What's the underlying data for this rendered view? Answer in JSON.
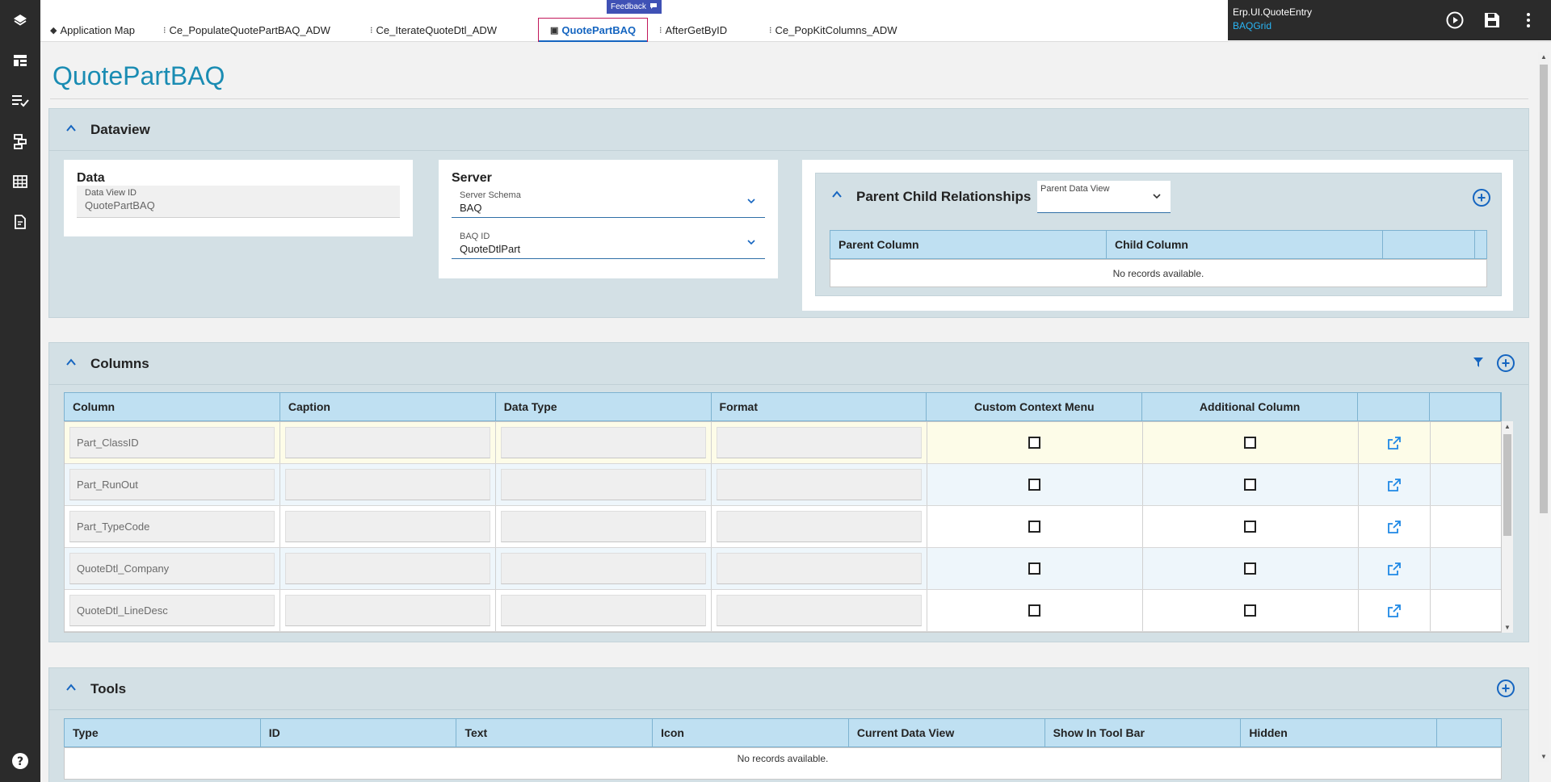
{
  "rail": {
    "icons": [
      "layers-icon",
      "layout-icon",
      "checklist-icon",
      "flow-icon",
      "grid-icon",
      "document-edit-icon",
      "help-icon"
    ]
  },
  "tabs": [
    {
      "label": "Application Map",
      "icon": "layers-icon"
    },
    {
      "label": "Ce_PopulateQuotePartBAQ_ADW",
      "icon": "workflow-icon"
    },
    {
      "label": "Ce_IterateQuoteDtl_ADW",
      "icon": "workflow-icon"
    },
    {
      "label": "QuotePartBAQ",
      "icon": "dataview-icon",
      "active": true
    },
    {
      "label": "AfterGetByID",
      "icon": "workflow-icon"
    },
    {
      "label": "Ce_PopKitColumns_ADW",
      "icon": "workflow-icon"
    }
  ],
  "feedback": {
    "label": "Feedback"
  },
  "app": {
    "name": "Erp.UI.QuoteEntry",
    "layer": "BAQGrid"
  },
  "page": {
    "title": "QuotePartBAQ"
  },
  "dataview": {
    "title": "Dataview",
    "data_card": {
      "title": "Data",
      "field_label": "Data View ID",
      "field_value": "QuotePartBAQ"
    },
    "server_card": {
      "title": "Server",
      "schema_label": "Server Schema",
      "schema_value": "BAQ",
      "baq_label": "BAQ ID",
      "baq_value": "QuoteDtlPart"
    },
    "relationships": {
      "title": "Parent Child Relationships",
      "parent_dv_label": "Parent Data View",
      "columns": [
        "Parent Column",
        "Child Column",
        ""
      ],
      "empty": "No records available."
    }
  },
  "columns_panel": {
    "title": "Columns",
    "headers": [
      "Column",
      "Caption",
      "Data Type",
      "Format",
      "Custom Context Menu",
      "Additional Column",
      "",
      ""
    ],
    "rows": [
      {
        "column": "Part_ClassID",
        "caption": "",
        "data_type": "",
        "format": ""
      },
      {
        "column": "Part_RunOut",
        "caption": "",
        "data_type": "",
        "format": ""
      },
      {
        "column": "Part_TypeCode",
        "caption": "",
        "data_type": "",
        "format": ""
      },
      {
        "column": "QuoteDtl_Company",
        "caption": "",
        "data_type": "",
        "format": ""
      },
      {
        "column": "QuoteDtl_LineDesc",
        "caption": "",
        "data_type": "",
        "format": ""
      }
    ]
  },
  "tools_panel": {
    "title": "Tools",
    "headers": [
      "Type",
      "ID",
      "Text",
      "Icon",
      "Current Data View",
      "Show In Tool Bar",
      "Hidden",
      ""
    ],
    "empty": "No records available."
  },
  "colors": {
    "accent": "#1a8cb3",
    "panel": "#d3e0e5",
    "header": "#bfe0f2",
    "rail": "#2b2b2b",
    "active_row": "#fdfce8",
    "alt_row": "#eef6fb"
  }
}
